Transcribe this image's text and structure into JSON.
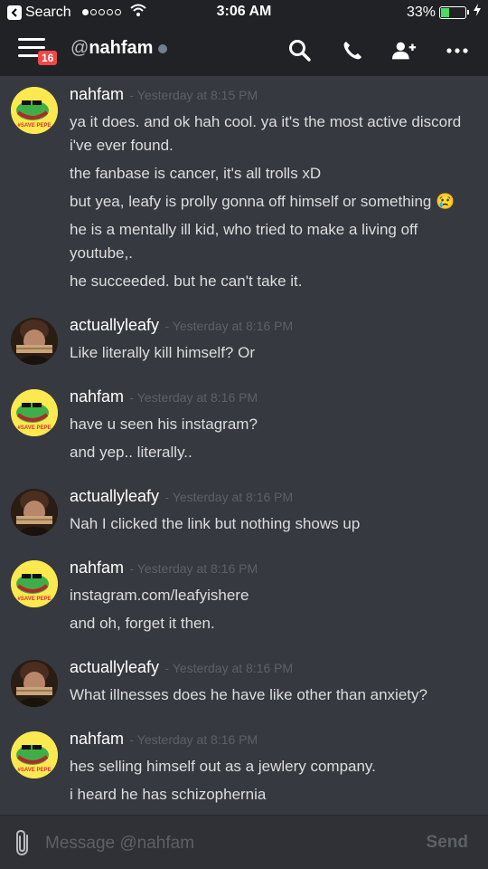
{
  "status_bar": {
    "back_label": "Search",
    "time": "3:06 AM",
    "battery": "33%",
    "battery_level": 0.33
  },
  "header": {
    "at": "@",
    "dm_name": "nahfam",
    "unread_badge": "16"
  },
  "messages": [
    {
      "author": "nahfam",
      "avatar": "pepe-avatar",
      "timestamp": "- Yesterday at 8:15 PM",
      "lines": [
        "ya it does. and ok hah cool. ya it's the most active discord i've ever found.",
        "the fanbase is cancer, it's all trolls xD",
        "but yea, leafy is prolly gonna off himself or something 😢",
        "he is a mentally ill kid, who tried to make a living off youtube,.",
        "he succeeded. but he can't take it."
      ]
    },
    {
      "author": "actuallyleafy",
      "avatar": "leafy-avatar",
      "timestamp": "- Yesterday at 8:16 PM",
      "lines": [
        "Like literally kill himself? Or"
      ]
    },
    {
      "author": "nahfam",
      "avatar": "pepe-avatar",
      "timestamp": "- Yesterday at 8:16 PM",
      "lines": [
        "have u seen his instagram?",
        "and yep.. literally.."
      ]
    },
    {
      "author": "actuallyleafy",
      "avatar": "leafy-avatar",
      "timestamp": "- Yesterday at 8:16 PM",
      "lines": [
        "Nah I clicked the link but nothing shows up"
      ]
    },
    {
      "author": "nahfam",
      "avatar": "pepe-avatar",
      "timestamp": "- Yesterday at 8:16 PM",
      "lines": [
        "instagram.com/leafyishere",
        "and oh, forget it then."
      ]
    },
    {
      "author": "actuallyleafy",
      "avatar": "leafy-avatar",
      "timestamp": "- Yesterday at 8:16 PM",
      "lines": [
        "What illnesses does he have like other than anxiety?"
      ]
    },
    {
      "author": "nahfam",
      "avatar": "pepe-avatar",
      "timestamp": "- Yesterday at 8:16 PM",
      "lines": [
        "hes selling himself out as a jewlery company.",
        "i heard he has schizophernia"
      ]
    }
  ],
  "composer": {
    "placeholder": "Message @nahfam",
    "send_label": "Send"
  },
  "avatar_text": {
    "pepe": "#SAVE PEPE"
  },
  "icons": [
    "back-arrow-icon",
    "wifi-icon",
    "menu-icon",
    "search-icon",
    "phone-icon",
    "add-friend-icon",
    "more-icon",
    "paperclip-icon",
    "charging-icon"
  ],
  "colors": {
    "background": "#36393f",
    "header": "#202225",
    "badge": "#f04747",
    "battery": "#4cd964"
  }
}
